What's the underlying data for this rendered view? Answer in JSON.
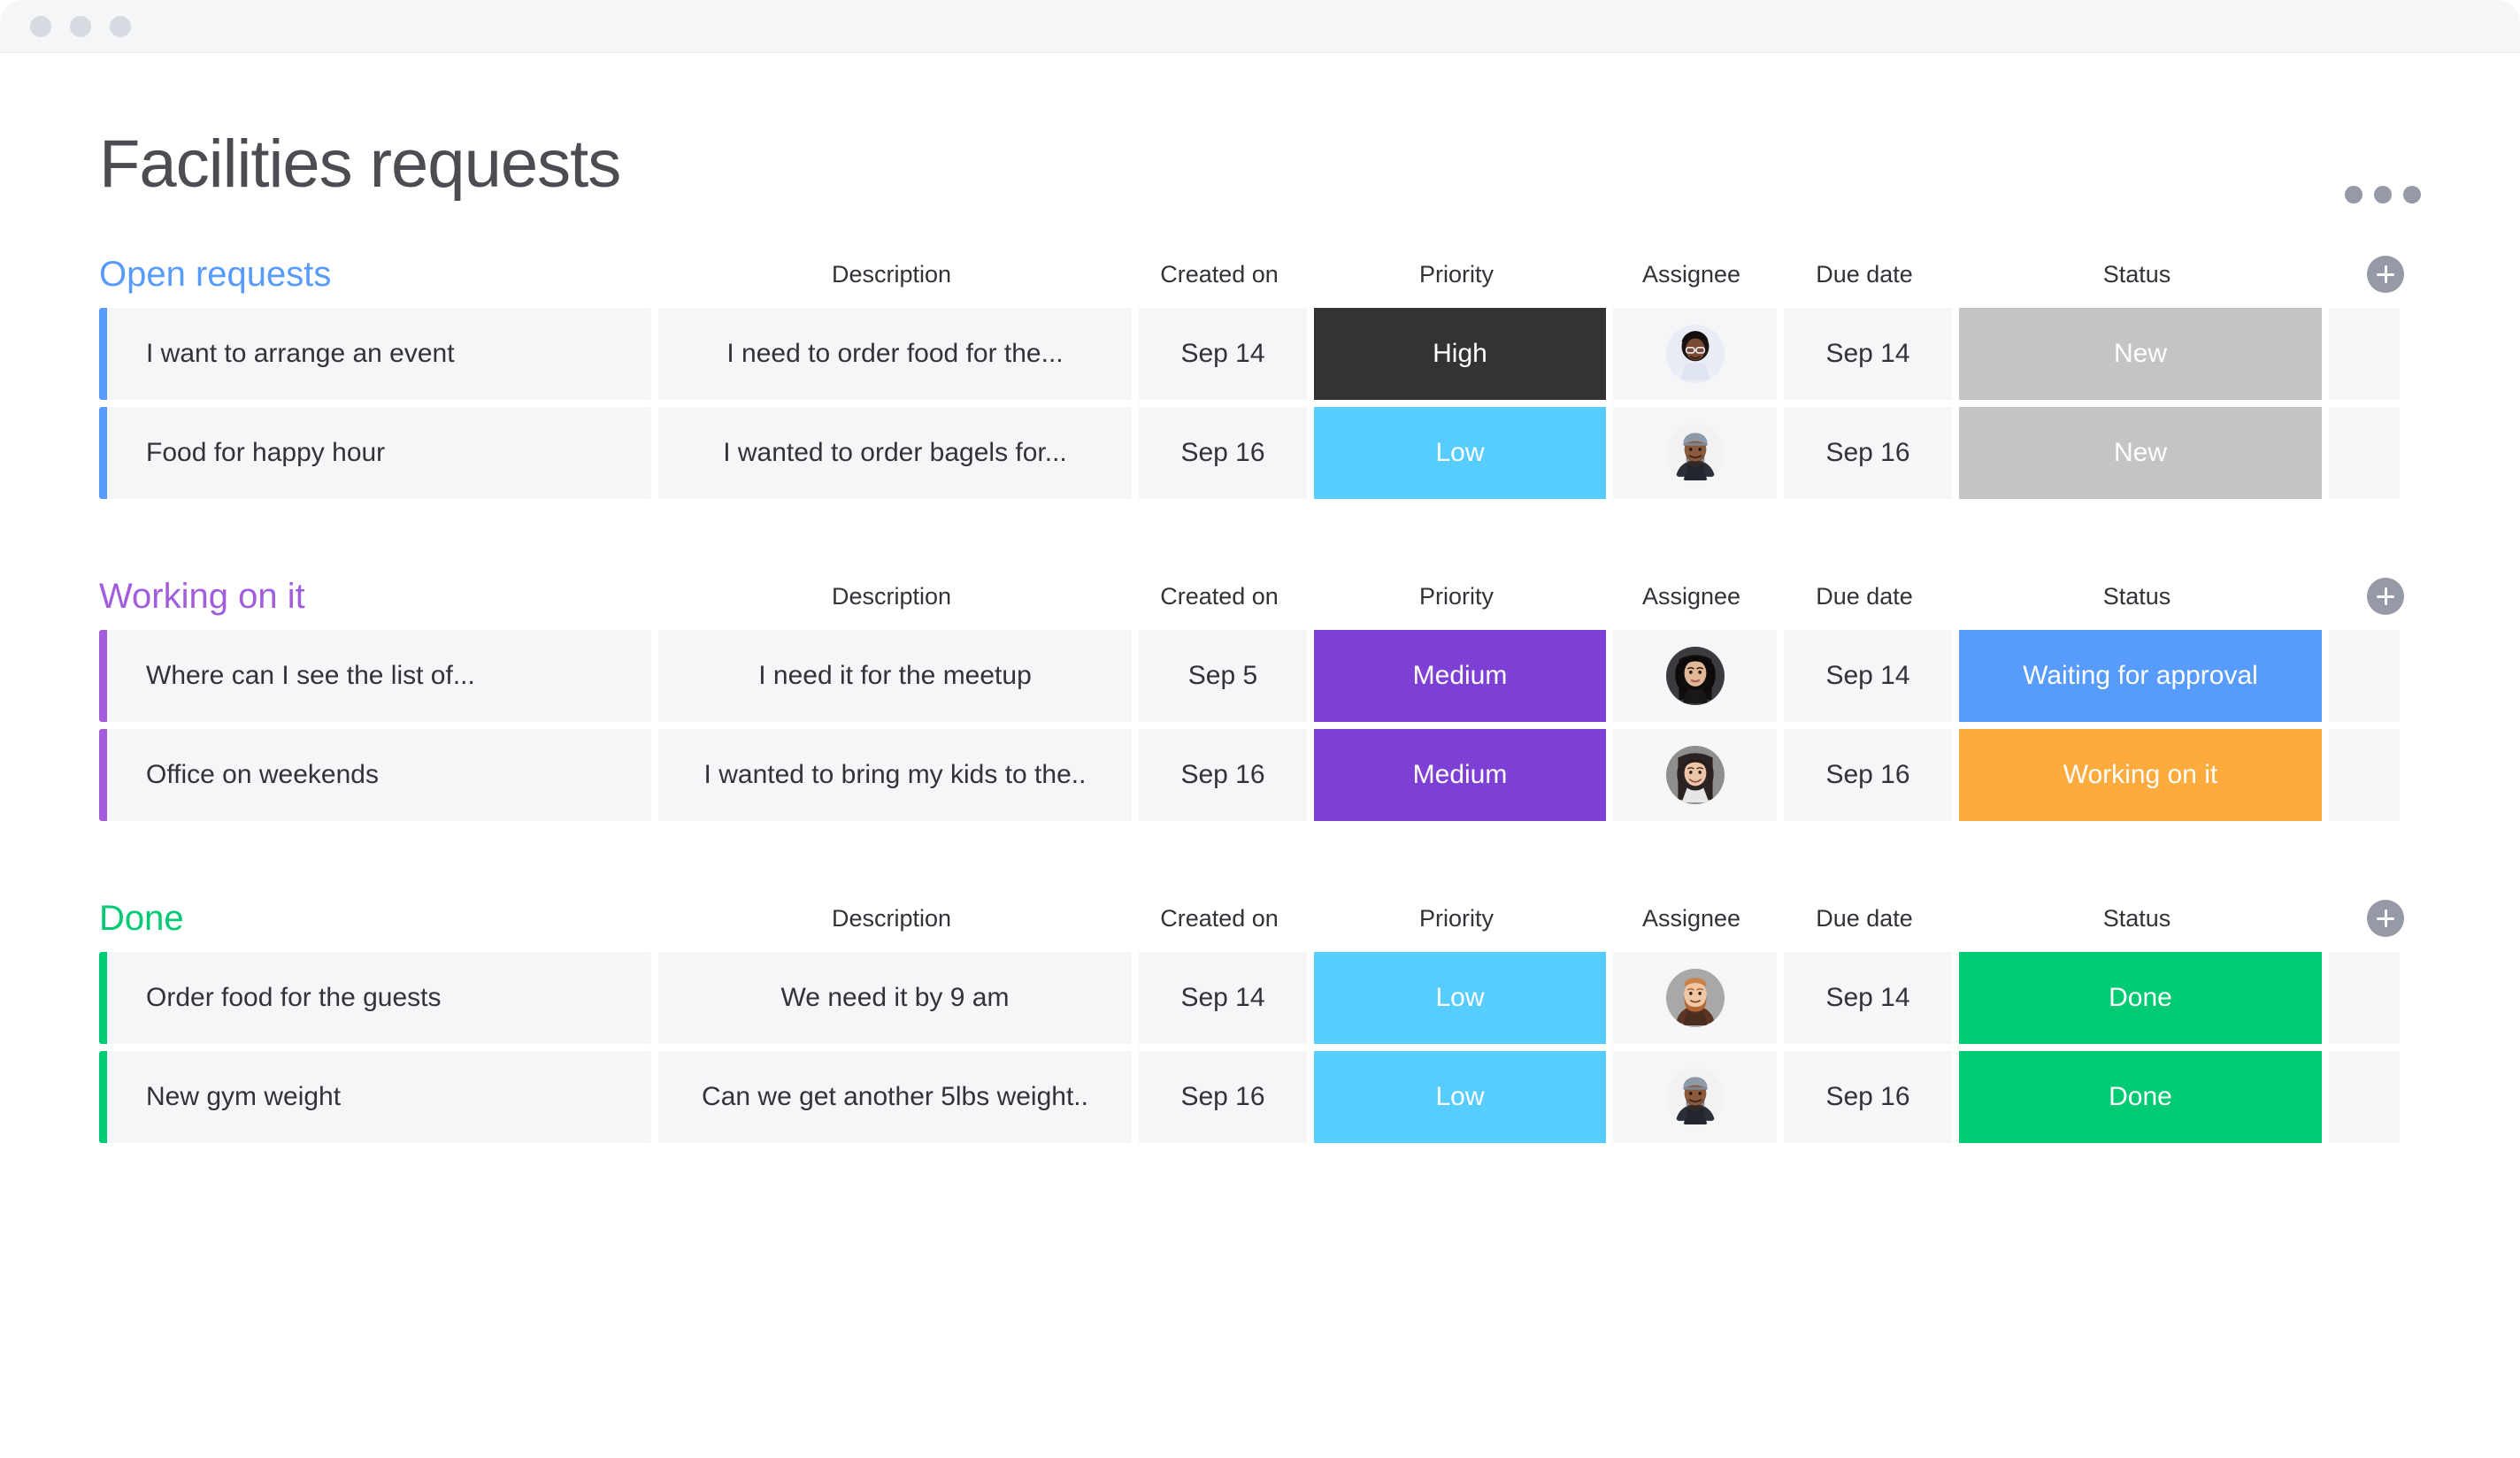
{
  "window": {
    "traffic_lights": [
      "close",
      "minimize",
      "maximize"
    ]
  },
  "header": {
    "title": "Facilities requests",
    "menu_icon": "kebab-menu-icon"
  },
  "columns": [
    "Description",
    "Created on",
    "Priority",
    "Assignee",
    "Due date",
    "Status"
  ],
  "colors": {
    "open_group": "#579bfc",
    "working_group": "#a25ddc",
    "done_group": "#00ca72",
    "priority_high": "#333333",
    "priority_medium": "#7e3fd4",
    "priority_low": "#56cdfd",
    "status_new": "#c4c4c4",
    "status_waiting": "#579bfc",
    "status_working": "#fdab3d",
    "status_done": "#00ca72",
    "row_bg": "#f5f6f8",
    "title_text": "#4b4d52"
  },
  "groups": [
    {
      "title": "Open requests",
      "accent": "#579bfc",
      "add_icon": "plus-icon",
      "columns": [
        "Description",
        "Created on",
        "Priority",
        "Assignee",
        "Due date",
        "Status"
      ],
      "rows": [
        {
          "name": "I want to arrange an event",
          "description": "I need to order food for the...",
          "created_on": "Sep 14",
          "priority": "High",
          "priority_color": "#333333",
          "assignee": "avatar-woman-glasses",
          "due_date": "Sep 14",
          "status": "New",
          "status_color": "#c4c4c4"
        },
        {
          "name": "Food for happy hour",
          "description": "I wanted to order bagels for...",
          "created_on": "Sep 16",
          "priority": "Low",
          "priority_color": "#56cdfd",
          "assignee": "avatar-man-cap",
          "due_date": "Sep 16",
          "status": "New",
          "status_color": "#c4c4c4"
        }
      ]
    },
    {
      "title": "Working on it",
      "accent": "#a25ddc",
      "add_icon": "plus-icon",
      "columns": [
        "Description",
        "Created on",
        "Priority",
        "Assignee",
        "Due date",
        "Status"
      ],
      "rows": [
        {
          "name": "Where can I see the list of...",
          "description": "I need it for the meetup",
          "created_on": "Sep 5",
          "priority": "Medium",
          "priority_color": "#7e3fd4",
          "assignee": "avatar-woman-dark-hair",
          "due_date": "Sep 14",
          "status": "Waiting for approval",
          "status_color": "#579bfc"
        },
        {
          "name": "Office on weekends",
          "description": "I wanted to bring my kids to the..",
          "created_on": "Sep 16",
          "priority": "Medium",
          "priority_color": "#7e3fd4",
          "assignee": "avatar-woman-smiling",
          "due_date": "Sep 16",
          "status": "Working on it",
          "status_color": "#fdab3d"
        }
      ]
    },
    {
      "title": "Done",
      "accent": "#00ca72",
      "add_icon": "plus-icon",
      "columns": [
        "Description",
        "Created on",
        "Priority",
        "Assignee",
        "Due date",
        "Status"
      ],
      "rows": [
        {
          "name": "Order food for the guests",
          "description": "We need it by 9 am",
          "created_on": "Sep 14",
          "priority": "Low",
          "priority_color": "#56cdfd",
          "assignee": "avatar-man-beard",
          "due_date": "Sep 14",
          "status": "Done",
          "status_color": "#00ca72"
        },
        {
          "name": "New gym weight",
          "description": "Can we get another 5lbs weight..",
          "created_on": "Sep 16",
          "priority": "Low",
          "priority_color": "#56cdfd",
          "assignee": "avatar-man-cap",
          "due_date": "Sep 16",
          "status": "Done",
          "status_color": "#00ca72"
        }
      ]
    }
  ]
}
